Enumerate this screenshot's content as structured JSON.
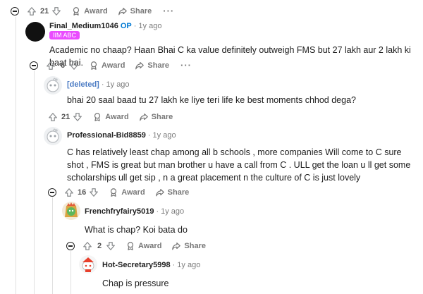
{
  "top_actions": {
    "count": "21",
    "award": "Award",
    "share": "Share",
    "more": "···"
  },
  "comments": [
    {
      "username": "Final_Medium1046",
      "op_badge": "OP",
      "dot": "·",
      "time": "1y ago",
      "flair": "IIM ABC",
      "text": "Academic no chaap? Haan Bhai C ka value definitely outweigh FMS but 27 lakh aur 2 lakh ki baat hai.",
      "votes": "6",
      "award": "Award",
      "share": "Share",
      "more": "···"
    },
    {
      "username": "[deleted]",
      "dot": "·",
      "time": "1y ago",
      "text": "bhai 20 saal baad tu 27 lakh ke liye teri life ke best moments chhod dega?",
      "votes": "21",
      "award": "Award",
      "share": "Share"
    },
    {
      "username": "Professional-Bid8859",
      "dot": "·",
      "time": "1y ago",
      "text": "C has relatively least chap among all b schools , more companies Will come to C sure shot , FMS is great but man brother u have a call from C . ULL get the loan u ll get some scholarships ull get sip , n a great placement n the culture of C is just lovely",
      "votes": "16",
      "award": "Award",
      "share": "Share"
    },
    {
      "username": "Frenchfryfairy5019",
      "dot": "·",
      "time": "1y ago",
      "text": "What is chap? Koi bata do",
      "votes": "2",
      "award": "Award",
      "share": "Share"
    },
    {
      "username": "Hot-Secretary5998",
      "dot": "·",
      "time": "1y ago",
      "text": "Chap is pressure"
    }
  ],
  "colors": {
    "op": "#0079d3",
    "flair_bg": "#ea4cff",
    "deleted": "#4c7cc4",
    "meta": "#7c7c7c"
  }
}
